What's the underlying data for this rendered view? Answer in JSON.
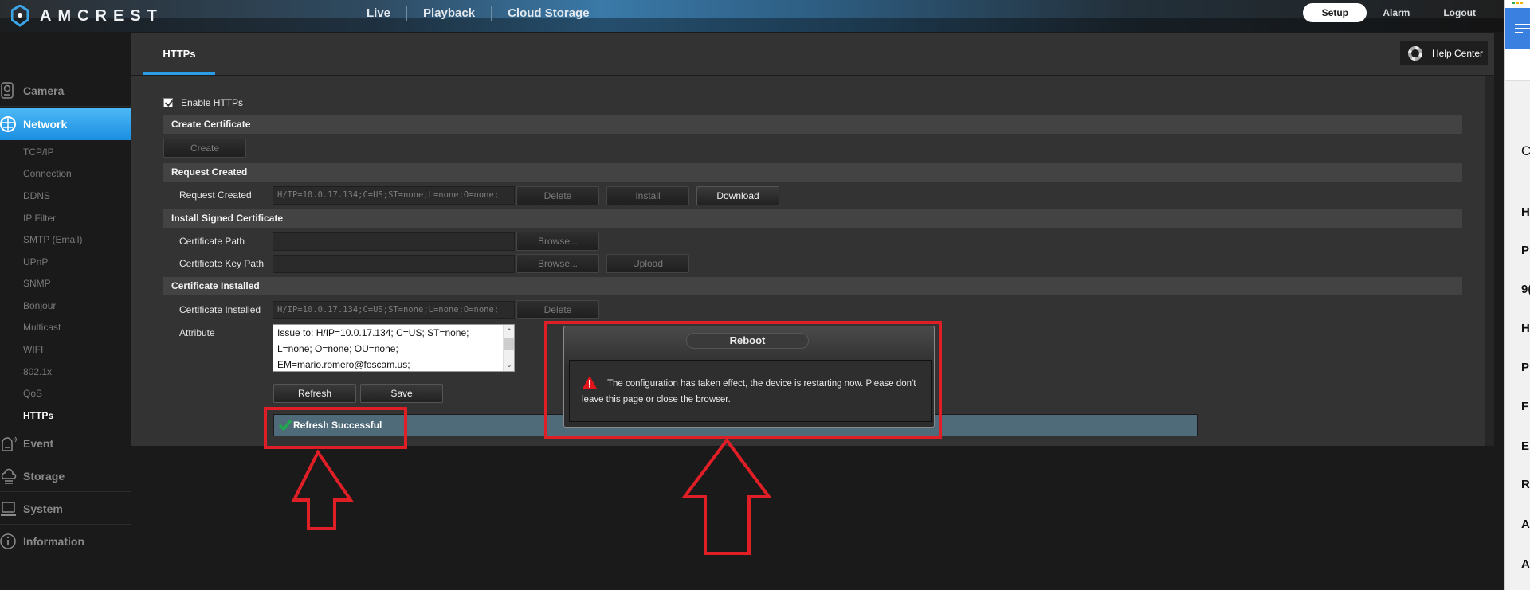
{
  "header": {
    "brand": "AMCREST",
    "nav": [
      "Live",
      "Playback",
      "Cloud Storage"
    ],
    "setup_label": "Setup",
    "alarm_label": "Alarm",
    "logout_label": "Logout"
  },
  "sidebar": {
    "sections": [
      {
        "label": "Camera",
        "icon": "camera-icon"
      },
      {
        "label": "Network",
        "icon": "network-globe-icon",
        "active": true
      },
      {
        "label": "Event",
        "icon": "alarm-bell-icon"
      },
      {
        "label": "Storage",
        "icon": "cloud-storage-icon"
      },
      {
        "label": "System",
        "icon": "laptop-icon"
      },
      {
        "label": "Information",
        "icon": "info-icon"
      }
    ],
    "network_items": [
      "TCP/IP",
      "Connection",
      "DDNS",
      "IP Filter",
      "SMTP (Email)",
      "UPnP",
      "SNMP",
      "Bonjour",
      "Multicast",
      "WIFI",
      "802.1x",
      "QoS",
      "HTTPs"
    ],
    "active_item": "HTTPs"
  },
  "content": {
    "tab": "HTTPs",
    "help_center": "Help Center",
    "enable_https_label": "Enable HTTPs",
    "enable_https_checked": true,
    "sections": {
      "create_certificate": "Create Certificate",
      "request_created": "Request Created",
      "install_signed": "Install Signed Certificate",
      "certificate_installed": "Certificate Installed"
    },
    "buttons": {
      "create": "Create",
      "delete": "Delete",
      "install": "Install",
      "download": "Download",
      "browse": "Browse...",
      "upload": "Upload",
      "refresh": "Refresh",
      "save": "Save"
    },
    "labels": {
      "request_created": "Request Created",
      "certificate_path": "Certificate Path",
      "certificate_key_path": "Certificate Key Path",
      "certificate_installed": "Certificate Installed",
      "attribute": "Attribute"
    },
    "values": {
      "request_created": "H/IP=10.0.17.134;C=US;ST=none;L=none;O=none;",
      "certificate_path": "",
      "certificate_key_path": "",
      "certificate_installed": "H/IP=10.0.17.134;C=US;ST=none;L=none;O=none;",
      "attribute_lines": [
        "Issue to: H/IP=10.0.17.134; C=US; ST=none;",
        "L=none; O=none; OU=none;",
        "EM=mario.romero@foscam.us;"
      ]
    },
    "status_message": "Refresh Successful"
  },
  "dialog": {
    "title": "Reboot",
    "message": "The configuration has taken effect, the device is restarting now. Please don't leave this page or close the browser."
  },
  "right_panel_letters": [
    "C",
    "H",
    "P",
    "9(",
    "H",
    "P",
    "F",
    "E",
    "R",
    "A",
    "A"
  ],
  "colors": {
    "accent": "#2a9ce8",
    "annotation_red": "#e01e26",
    "status_bar": "#4f6a78",
    "success_check": "#1fa84f",
    "warning": "#e0161c"
  }
}
